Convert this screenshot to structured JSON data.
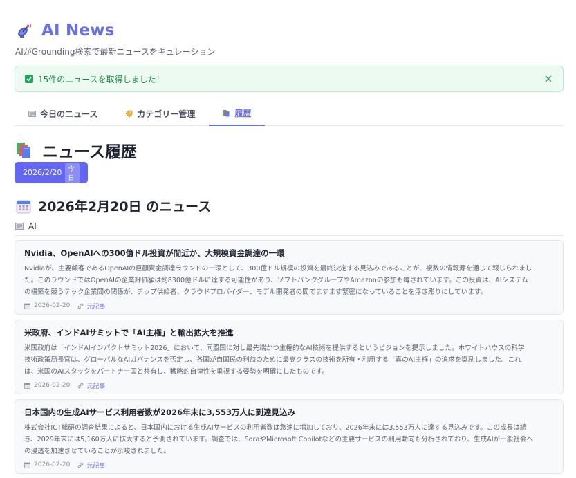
{
  "app": {
    "title": "AI News",
    "subtitle": "AIがGrounding検索で最新ニュースをキュレーション",
    "icon": "satellite-dish-icon"
  },
  "alert": {
    "message": "15件のニュースを取得しました！",
    "status_color": "#22a55b"
  },
  "tabs": [
    {
      "label": "今日のニュース",
      "icon": "newspaper-icon",
      "active": false
    },
    {
      "label": "カテゴリー管理",
      "icon": "label-tag-icon",
      "active": false
    },
    {
      "label": "履歴",
      "icon": "books-icon",
      "active": true
    }
  ],
  "history": {
    "title": "ニュース履歴",
    "icon": "books-icon",
    "selected_date": "2026/2/20",
    "today_badge": "今日"
  },
  "day": {
    "title": "2026年2月20日 のニュース",
    "icon": "calendar-icon"
  },
  "category": {
    "label": "AI",
    "icon": "newspaper-icon"
  },
  "articles": [
    {
      "title": "Nvidia、OpenAIへの300億ドル投資が間近か、大規模資金調達の一環",
      "body_lines": [
        "Nvidiaが、主要顧客であるOpenAIの巨額資金調達ラウンドの一環として、300億ドル規模の投資を最終決定する見込みであることが、複数の情報源を通じて報じられまし",
        "た。このラウンドではOpenAIの企業評価額は約8300億ドルに達する可能性があり、ソフトバンクグループやAmazonの参加も噂されています。この投資は、AIシステム",
        "の構築を競うテック企業間の関係が、チップ供給者、クラウドプロバイダー、モデル開発者の間でますます緊密になっていることを浮き彫りにしています。"
      ],
      "date": "2026-02-20",
      "source_label": "元記事"
    },
    {
      "title": "米政府、インドAIサミットで「AI主権」と輸出拡大を推進",
      "body_lines": [
        "米国政府は「インドAIインパクトサミット2026」において、同盟国に対し最先端かつ主権的なAI技術を提供するというビジョンを提示しました。ホワイトハウスの科学",
        "技術政策局長官は、グローバルなAIガバナンスを否定し、各国が自国民の利益のために最高クラスの技術を所有・利用する「真のAI主権」の追求を奨励しました。これ",
        "は、米国のAIスタックをパートナー国と共有し、戦略的自律性を重視する姿勢を明確にしたものです。"
      ],
      "date": "2026-02-20",
      "source_label": "元記事"
    },
    {
      "title": "日本国内の生成AIサービス利用者数が2026年末に3,553万人に到達見込み",
      "body_lines": [
        "株式会社ICT総研の調査結果によると、日本国内における生成AIサービスの利用者数は急速に増加しており、2026年末には3,553万人に達する見込みです。この成長は続",
        "き、2029年末には5,160万人に拡大すると予測されています。調査では、SoraやMicrosoft Copilotなどの主要サービスの利用動向も分析されており、生成AIが一般社会へ",
        "の浸透を加速させていることが示唆されました。"
      ],
      "date": "2026-02-20",
      "source_label": "元記事"
    }
  ],
  "colors": {
    "accent": "#6a70e0",
    "button": "#6366f1",
    "success_bg": "#ecfaf1",
    "success_text": "#1c8a4a"
  }
}
